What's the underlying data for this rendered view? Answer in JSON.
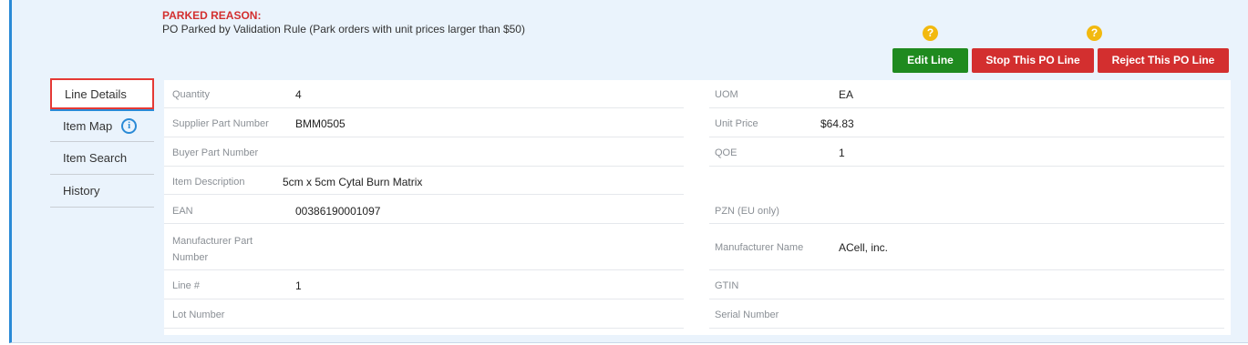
{
  "parked": {
    "title": "PARKED REASON:",
    "message": "PO Parked by Validation Rule (Park orders with unit prices larger than $50)"
  },
  "help_glyph": "?",
  "buttons": {
    "edit": "Edit Line",
    "stop": "Stop This PO Line",
    "reject": "Reject This PO Line"
  },
  "tabs": [
    "Line Details",
    "Item Map",
    "Item Search",
    "History"
  ],
  "info_glyph": "i",
  "left_fields": [
    {
      "label": "Quantity",
      "value": "4"
    },
    {
      "label": "Supplier Part Number",
      "value": "BMM0505"
    },
    {
      "label": "Buyer Part Number",
      "value": ""
    },
    {
      "label": "Item Description",
      "value": "5cm x 5cm Cytal Burn Matrix"
    },
    {
      "label": "EAN",
      "value": "00386190001097"
    },
    {
      "label": "Manufacturer Part Number",
      "value": ""
    },
    {
      "label": "Line #",
      "value": "1"
    },
    {
      "label": "Lot Number",
      "value": ""
    }
  ],
  "right_fields": [
    {
      "label": "UOM",
      "value": "EA"
    },
    {
      "label": "Unit Price",
      "value": "$64.83"
    },
    {
      "label": "QOE",
      "value": "1"
    },
    {
      "label": "",
      "value": ""
    },
    {
      "label": "PZN (EU only)",
      "value": ""
    },
    {
      "label": "Manufacturer Name",
      "value": "ACell, inc."
    },
    {
      "label": "GTIN",
      "value": ""
    },
    {
      "label": "Serial Number",
      "value": ""
    }
  ],
  "colors": {
    "accent": "#2a8ad6",
    "danger": "#d32f2f",
    "success": "#1f8a1f",
    "help": "#f2b90f"
  }
}
